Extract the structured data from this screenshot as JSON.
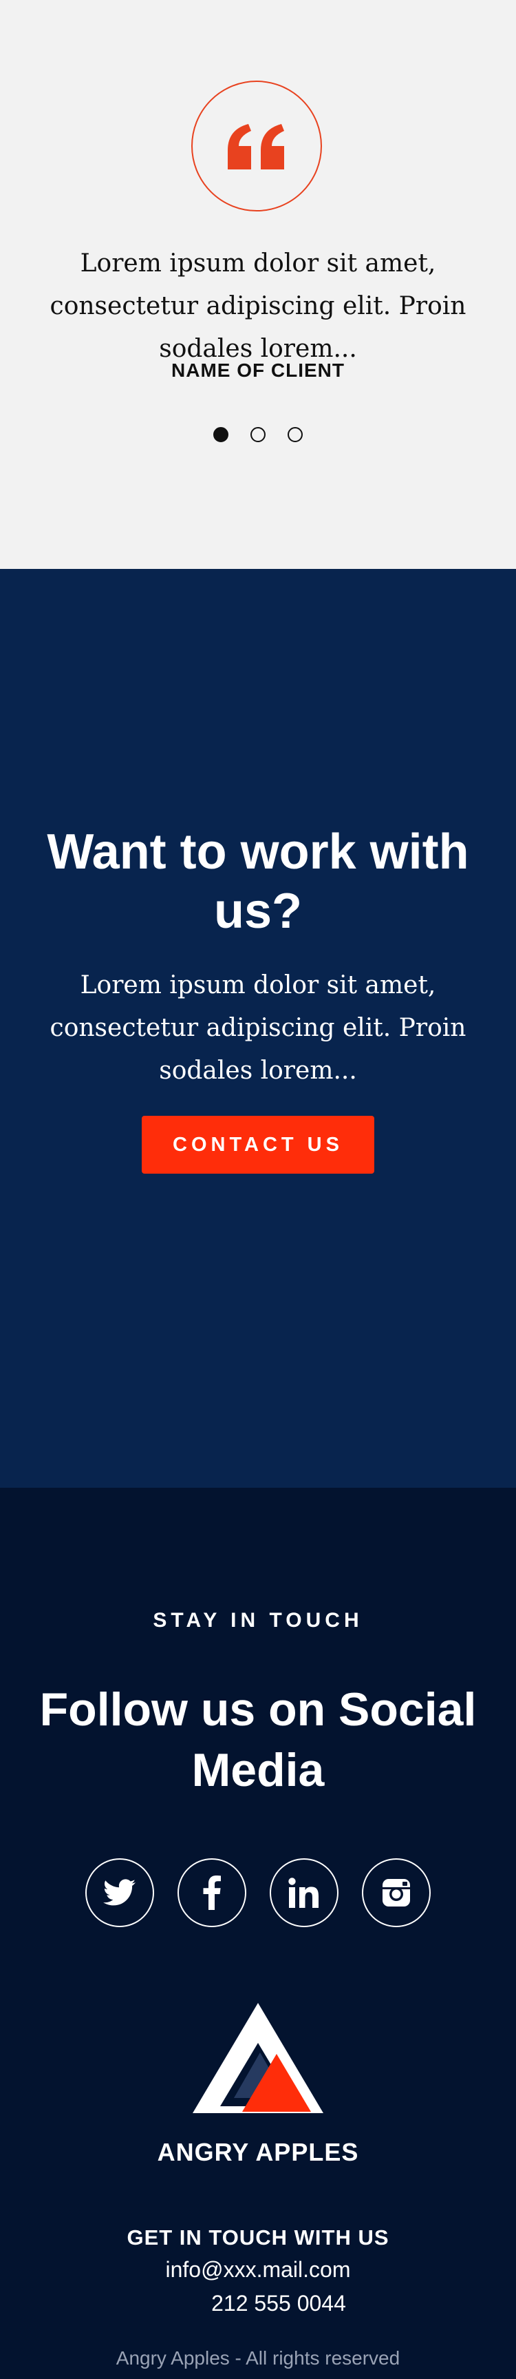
{
  "testimonial": {
    "quote_text": "Lorem ipsum dolor sit amet, consectetur adipiscing elit. Proin  sodales lorem...",
    "client_name": "NAME OF CLIENT",
    "dots": 3,
    "active_dot": 1,
    "accent_color": "#e8421f"
  },
  "cta": {
    "title": "Want to work with us?",
    "text": "Lorem ipsum dolor sit amet, consectetur adipiscing elit. Proin  sodales lorem...",
    "button_label": "CONTACT US",
    "background": "#08244e",
    "button_color": "#ff2d0a"
  },
  "footer": {
    "eyebrow": "STAY IN TOUCH",
    "title": "Follow us on Social Media",
    "socials": [
      "twitter-icon",
      "facebook-icon",
      "linkedin-icon",
      "instagram-icon"
    ],
    "brand_name": "ANGRY APPLES",
    "contact_heading": "GET IN TOUCH WITH US",
    "email": "info@xxx.mail.com",
    "phone": "212 555 0044",
    "copyright": "Angry Apples - All rights reserved",
    "background": "#03132f"
  }
}
